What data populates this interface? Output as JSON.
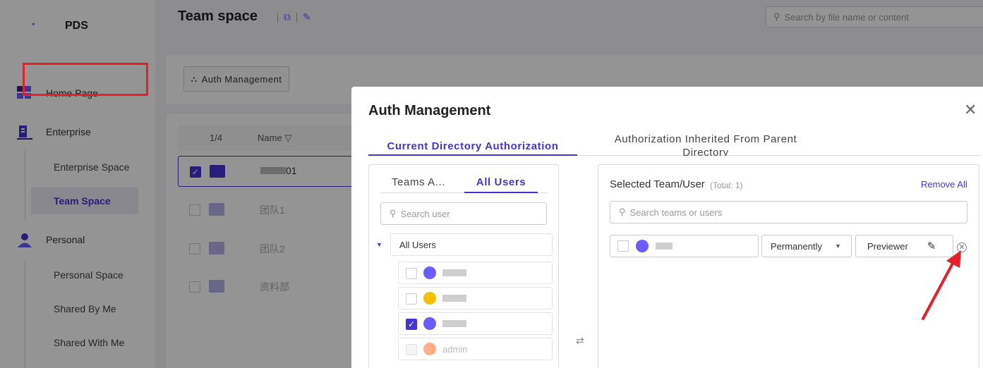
{
  "app": {
    "brand": "PDS"
  },
  "sidebar": {
    "items": [
      {
        "label": "Home Page"
      },
      {
        "label": "Enterprise"
      },
      {
        "label": "Personal"
      }
    ],
    "enterprise_sub": [
      {
        "label": "Enterprise Space"
      },
      {
        "label": "Team Space"
      }
    ],
    "personal_sub": [
      {
        "label": "Personal Space"
      },
      {
        "label": "Shared By Me"
      },
      {
        "label": "Shared With Me"
      }
    ]
  },
  "header": {
    "title": "Team space",
    "search_placeholder": "Search by file name or content"
  },
  "toolbar": {
    "auth_button": "Auth Management"
  },
  "table": {
    "page_indicator": "1/4",
    "name_header": "Name",
    "rows": [
      {
        "name": "01",
        "selected": true
      },
      {
        "name": "团队1",
        "selected": false
      },
      {
        "name": "团队2",
        "selected": false
      },
      {
        "name": "资料部",
        "selected": false
      }
    ]
  },
  "modal": {
    "title": "Auth Management",
    "tabs": [
      {
        "label": "Current Directory Authorization"
      },
      {
        "label": "Authorization Inherited From Parent Directory"
      }
    ],
    "left": {
      "tabs": [
        {
          "label": "Teams A..."
        },
        {
          "label": "All Users"
        }
      ],
      "search_placeholder": "Search user",
      "tree_root": "All Users",
      "users": [
        {
          "name": "",
          "checked": false,
          "avatar_color": "#6a5cff"
        },
        {
          "name": "",
          "checked": false,
          "avatar_color": "#f2c200"
        },
        {
          "name": "",
          "checked": true,
          "avatar_color": "#6a5cff"
        },
        {
          "name": "admin",
          "checked": false,
          "avatar_color": "#ffb08a",
          "disabled": true
        }
      ]
    },
    "right": {
      "title": "Selected Team/User",
      "total": "(Total: 1)",
      "remove_all": "Remove All",
      "search_placeholder": "Search teams or users",
      "selected": [
        {
          "name": "",
          "duration": "Permanently",
          "role": "Previewer"
        }
      ]
    }
  }
}
